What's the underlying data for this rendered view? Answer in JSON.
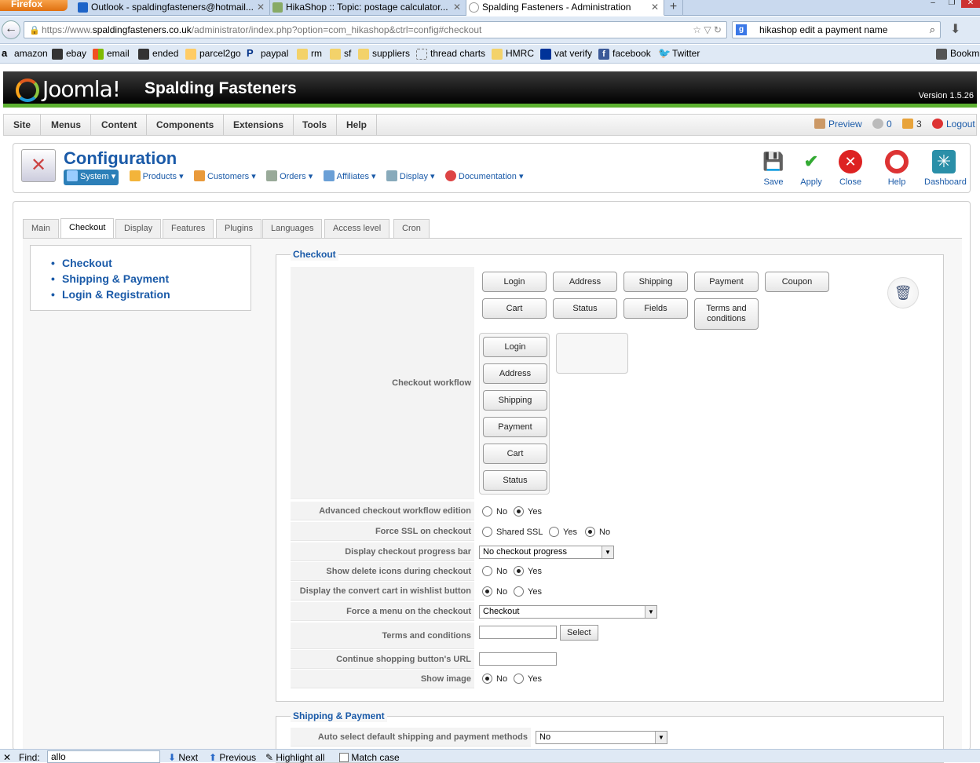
{
  "browser": {
    "app_button": "Firefox",
    "tabs": [
      {
        "title": "Outlook - spaldingfasteners@hotmail...",
        "icon": "outlook-icon"
      },
      {
        "title": "HikaShop :: Topic: postage calculator...",
        "icon": "hikashop-icon"
      },
      {
        "title": "Spalding Fasteners - Administration",
        "icon": "globe-icon"
      }
    ],
    "url_prefix": "https://www.",
    "url_domain": "spaldingfasteners.co.uk",
    "url_path": "/administrator/index.php?option=com_hikashop&ctrl=config#checkout",
    "search_text": "hikashop edit a payment name",
    "bookmarks": [
      "amazon",
      "ebay",
      "email",
      "ended",
      "parcel2go",
      "paypal",
      "rm",
      "sf",
      "suppliers",
      "thread charts",
      "HMRC",
      "vat verify",
      "facebook",
      "Twitter"
    ],
    "bookmarks_menu": "Bookm"
  },
  "joomla": {
    "logo_text": "Joomla!",
    "site_name": "Spalding Fasteners",
    "version": "Version 1.5.26",
    "menu": [
      "Site",
      "Menus",
      "Content",
      "Components",
      "Extensions",
      "Tools",
      "Help"
    ],
    "preview": "Preview",
    "messages": "0",
    "users": "3",
    "logout": "Logout"
  },
  "toolbar": {
    "title": "Configuration",
    "submenu": [
      "System",
      "Products",
      "Customers",
      "Orders",
      "Affiliates",
      "Display",
      "Documentation"
    ],
    "buttons": [
      "Save",
      "Apply",
      "Close",
      "Help",
      "Dashboard"
    ]
  },
  "tabs": [
    "Main",
    "Checkout",
    "Display",
    "Features",
    "Plugins",
    "Languages",
    "Access level",
    "Cron"
  ],
  "sidenav": [
    "Checkout",
    "Shipping & Payment",
    "Login & Registration"
  ],
  "checkout": {
    "legend": "Checkout",
    "workflow_label": "Checkout workflow",
    "available": [
      "Login",
      "Address",
      "Shipping",
      "Payment",
      "Coupon",
      "Cart",
      "Status",
      "Fields",
      "Terms and conditions"
    ],
    "workflow_steps": [
      "Login",
      "Address",
      "Shipping",
      "Payment",
      "Cart",
      "Status"
    ],
    "rows": {
      "advanced": "Advanced checkout workflow edition",
      "ssl": "Force SSL on checkout",
      "progress": "Display checkout progress bar",
      "delete_icons": "Show delete icons during checkout",
      "wishlist": "Display the convert cart in wishlist button",
      "force_menu": "Force a menu on the checkout",
      "terms": "Terms and conditions",
      "continue_url": "Continue shopping button's URL",
      "show_image": "Show image"
    },
    "opt_no": "No",
    "opt_yes": "Yes",
    "opt_shared_ssl": "Shared SSL",
    "progress_value": "No checkout progress",
    "menu_value": "Checkout",
    "select_btn": "Select"
  },
  "shipping": {
    "legend": "Shipping & Payment",
    "auto_select_label": "Auto select default shipping and payment methods",
    "auto_select_value": "No"
  },
  "findbar": {
    "label": "Find:",
    "value": "allo",
    "next": "Next",
    "previous": "Previous",
    "highlight": "Highlight all",
    "match_case": "Match case"
  }
}
